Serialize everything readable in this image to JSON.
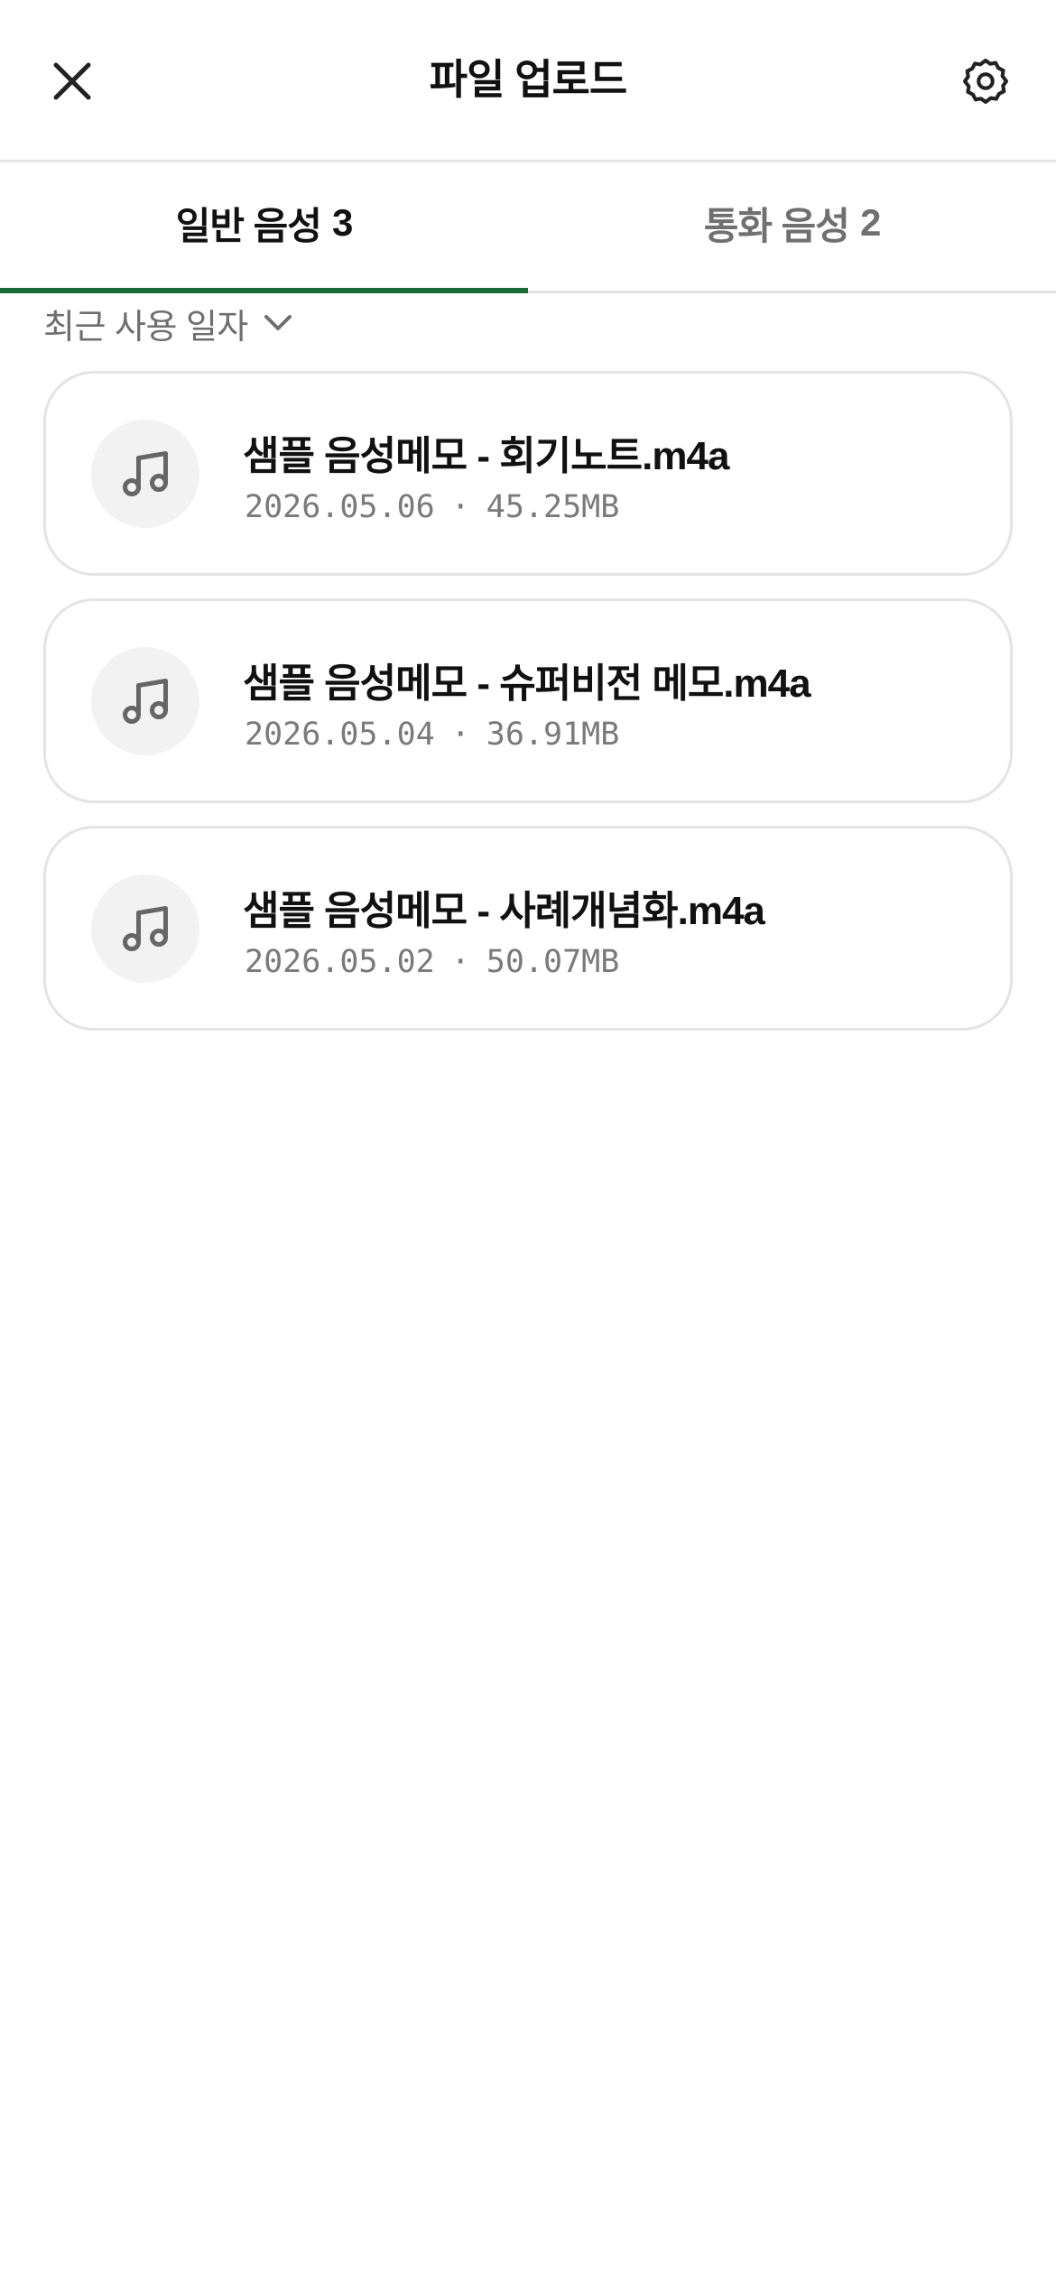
{
  "header": {
    "title": "파일 업로드",
    "close_icon": "close-icon",
    "settings_icon": "gear-icon"
  },
  "tabs": [
    {
      "label": "일반 음성",
      "count": "3",
      "active": true
    },
    {
      "label": "통화 음성",
      "count": "2",
      "active": false
    }
  ],
  "sort": {
    "label": "최근 사용 일자",
    "icon": "chevron-down-icon"
  },
  "files": [
    {
      "name": "샘플 음성메모 - 회기노트.m4a",
      "date": "2026.05.06",
      "separator": "·",
      "size": "45.25MB",
      "icon": "music-note-icon"
    },
    {
      "name": "샘플 음성메모 - 슈퍼비전 메모.m4a",
      "date": "2026.05.04",
      "separator": "·",
      "size": "36.91MB",
      "icon": "music-note-icon"
    },
    {
      "name": "샘플 음성메모 - 사례개념화.m4a",
      "date": "2026.05.02",
      "separator": "·",
      "size": "50.07MB",
      "icon": "music-note-icon"
    }
  ],
  "colors": {
    "accent": "#1a6b35",
    "text_primary": "#111111",
    "text_secondary": "#707070",
    "border": "#e4e4e4"
  }
}
